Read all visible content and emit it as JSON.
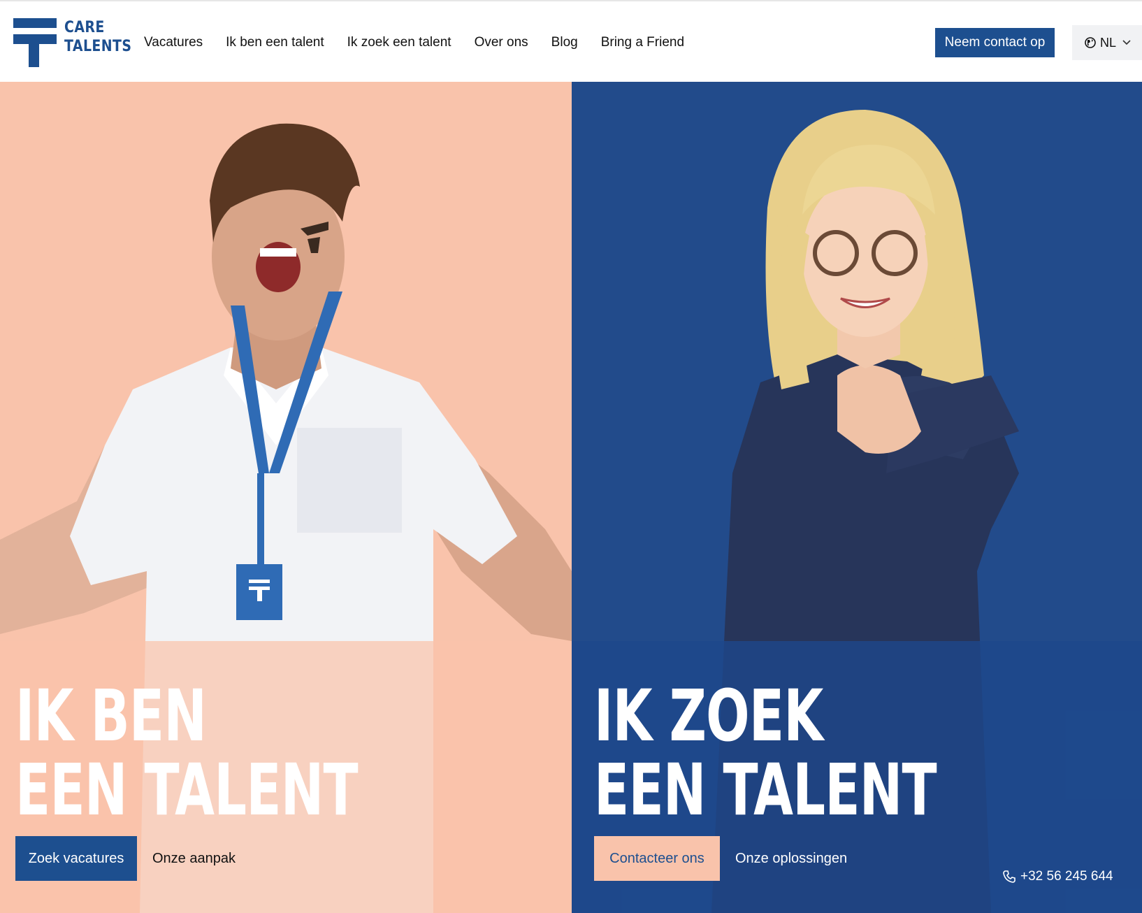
{
  "brand": {
    "line1": "CARE",
    "line2": "TALENTS",
    "color": "#1d4f8f"
  },
  "nav": {
    "items": [
      {
        "label": "Vacatures"
      },
      {
        "label": "Ik ben een talent"
      },
      {
        "label": "Ik zoek een talent"
      },
      {
        "label": "Over ons"
      },
      {
        "label": "Blog"
      },
      {
        "label": "Bring a Friend"
      }
    ]
  },
  "header": {
    "contact_label": "Neem contact op",
    "language": "NL",
    "language_icon": "globe-icon",
    "language_chevron_icon": "chevron-down-icon"
  },
  "left_panel": {
    "headline_line1": "IK BEN",
    "headline_line2": "EEN TALENT",
    "primary_label": "Zoek vacatures",
    "secondary_label": "Onze aanpak",
    "background": "#f9c3ab"
  },
  "right_panel": {
    "headline_line1": "IK ZOEK",
    "headline_line2": "EEN TALENT",
    "primary_label": "Contacteer ons",
    "secondary_label": "Onze oplossingen",
    "background": "#224b8b"
  },
  "phone": {
    "icon": "phone-icon",
    "number": "+32 56 245 644"
  }
}
